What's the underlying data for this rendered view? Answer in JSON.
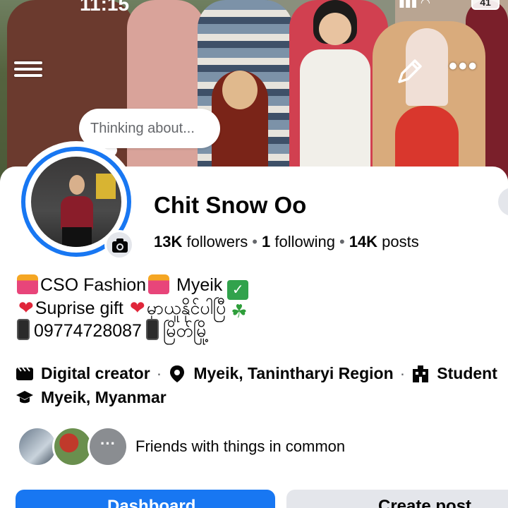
{
  "status_bar": {
    "time": "11:15",
    "battery": "41"
  },
  "header": {
    "menu_icon": "hamburger-icon",
    "edit_icon": "pencil-icon",
    "more_icon": "ellipsis-icon"
  },
  "note_bubble": {
    "text": "Thinking about..."
  },
  "profile": {
    "name": "Chit Snow Oo",
    "stats": [
      {
        "count": "13K",
        "label": "followers"
      },
      {
        "count": "1",
        "label": "following"
      },
      {
        "count": "14K",
        "label": "posts"
      }
    ],
    "camera_icon": "camera-icon"
  },
  "bio": {
    "line1": {
      "text": "CSO Fashion",
      "text2": "Myeik"
    },
    "line2": {
      "text": "Suprise gift",
      "text2": "မှာယူနိုင်ပါပြီ"
    },
    "line3": {
      "text": "09774728087",
      "text2": "မြိတ်မြို့"
    }
  },
  "details": {
    "category": "Digital creator",
    "location": "Myeik, Tanintharyi Region",
    "education": "Student",
    "hometown": "Myeik, Myanmar"
  },
  "mutual": {
    "text": "Friends with things in common",
    "more": "···"
  },
  "buttons": {
    "primary": "Dashboard",
    "secondary": "Create post"
  },
  "colors": {
    "accent": "#1877f2",
    "text": "#050505",
    "secondary_text": "#65676b",
    "button_gray": "#e4e6eb"
  }
}
